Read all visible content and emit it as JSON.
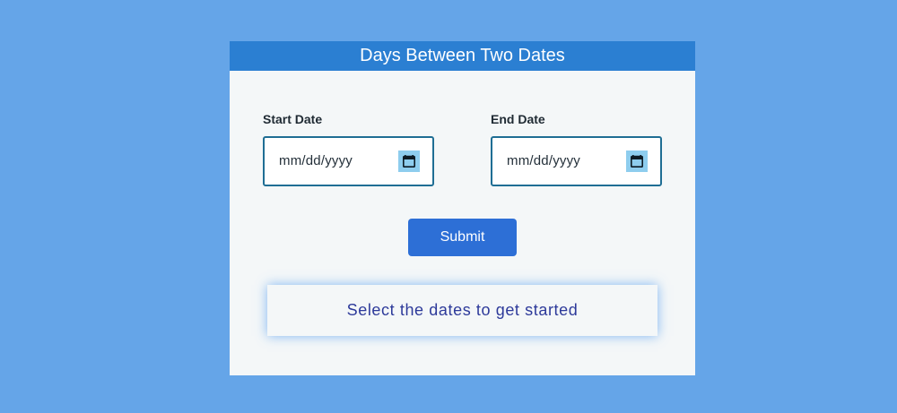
{
  "app": {
    "title": "Days Between Two Dates"
  },
  "form": {
    "start": {
      "label": "Start Date",
      "placeholder": "mm/dd/yyyy"
    },
    "end": {
      "label": "End Date",
      "placeholder": "mm/dd/yyyy"
    },
    "submit_label": "Submit"
  },
  "result": {
    "message": "Select the dates to get started"
  },
  "icons": {
    "calendar": "calendar-icon"
  },
  "colors": {
    "background": "#65a5e8",
    "header": "#2b7fd2",
    "button": "#2d6fd6",
    "calendar_button": "#8ecdee",
    "result_text": "#2d3a9a"
  }
}
